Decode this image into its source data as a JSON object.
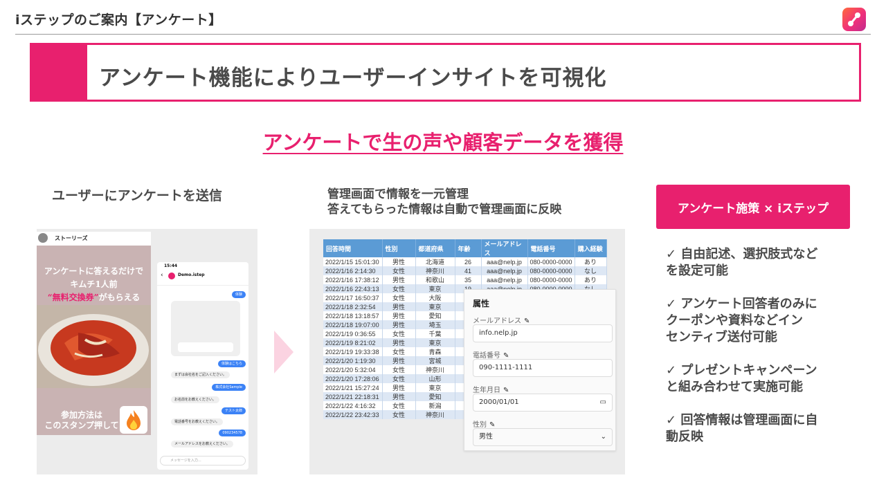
{
  "header": {
    "title": "iステップのご案内【アンケート】"
  },
  "headline": "アンケート機能によりユーザーインサイトを可視化",
  "sub_headline": "アンケートで生の声や顧客データを獲得",
  "col1": {
    "title": "ユーザーにアンケートを送信",
    "story": {
      "header_label": "ストーリーズ",
      "line1": "アンケートに答えるだけで",
      "line2": "キムチ1人前",
      "line3a": "“無料交換券”",
      "line3b": "がもらえる",
      "line4": "参加方法は",
      "line5": "このスタンプ押して"
    },
    "chat": {
      "time": "15:44",
      "account": "Demo.istep",
      "bubbles_right": [
        "体験",
        "体験はこちら",
        "株式会社Sample",
        "テスト太郎",
        "090234578"
      ],
      "bubbles_left": [
        "まずは会社名をご記入ください。",
        "お名前をお教えください。",
        "電話番号をお教えください。",
        "メールアドレスをお教えください。"
      ],
      "input_placeholder": "メッセージを入力..."
    }
  },
  "col2": {
    "title_line1": "管理画面で情報を一元管理",
    "title_line2": "答えてもらった情報は自動で管理画面に反映",
    "table": {
      "headers": [
        "回答時間",
        "性別",
        "都道府県",
        "年齢",
        "メールアドレス",
        "電話番号",
        "購入経験"
      ],
      "rows": [
        [
          "2022/1/15 15:01:30",
          "男性",
          "北海道",
          "26",
          "aaa@nelp.jp",
          "080-0000-0000",
          "あり"
        ],
        [
          "2022/1/16 2:14:30",
          "女性",
          "神奈川",
          "41",
          "aaa@nelp.jp",
          "080-0000-0000",
          "なし"
        ],
        [
          "2022/1/16 17:38:12",
          "男性",
          "和歌山",
          "35",
          "aaa@nelp.jp",
          "080-0000-0000",
          "あり"
        ],
        [
          "2022/1/16 22:43:13",
          "女性",
          "東京",
          "19",
          "aaa@nelp.jp",
          "080-0000-0000",
          "なし"
        ],
        [
          "2022/1/17 16:50:37",
          "女性",
          "大阪",
          "",
          "",
          "",
          ""
        ],
        [
          "2022/1/18 2:32:54",
          "男性",
          "東京",
          "",
          "",
          "",
          ""
        ],
        [
          "2022/1/18 13:18:57",
          "男性",
          "愛知",
          "",
          "",
          "",
          ""
        ],
        [
          "2022/1/18 19:07:00",
          "男性",
          "埼玉",
          "",
          "",
          "",
          ""
        ],
        [
          "2022/1/19 0:36:55",
          "女性",
          "千葉",
          "",
          "",
          "",
          ""
        ],
        [
          "2022/1/19 8:21:02",
          "男性",
          "東京",
          "",
          "",
          "",
          ""
        ],
        [
          "2022/1/19 19:33:38",
          "女性",
          "青森",
          "",
          "",
          "",
          ""
        ],
        [
          "2022/1/20 1:19:30",
          "男性",
          "宮城",
          "",
          "",
          "",
          ""
        ],
        [
          "2022/1/20 5:32:04",
          "女性",
          "神奈川",
          "",
          "",
          "",
          ""
        ],
        [
          "2022/1/20 17:28:06",
          "女性",
          "山形",
          "",
          "",
          "",
          ""
        ],
        [
          "2022/1/21 15:27:24",
          "男性",
          "東京",
          "",
          "",
          "",
          ""
        ],
        [
          "2022/1/21 22:18:31",
          "男性",
          "愛知",
          "",
          "",
          "",
          ""
        ],
        [
          "2022/1/22 4:16:32",
          "女性",
          "新潟",
          "",
          "",
          "",
          ""
        ],
        [
          "2022/1/22 23:42:33",
          "女性",
          "神奈川",
          "",
          "",
          "",
          ""
        ]
      ]
    },
    "attr_panel": {
      "title": "属性",
      "fields": [
        {
          "label": "メールアドレス",
          "value": "info.nelp.jp"
        },
        {
          "label": "電話番号",
          "value": "090-1111-1111"
        },
        {
          "label": "生年月日",
          "value": "2000/01/01"
        },
        {
          "label": "性別",
          "value": "男性"
        }
      ]
    }
  },
  "col3": {
    "badge": "アンケート施策 × iステップ",
    "features": [
      "✓ 自由記述、選択肢式など\nを設定可能",
      "✓ アンケート回答者のみに\nクーポンや資料などイン\nセンティブ送付可能",
      "✓ プレゼントキャンペーン\nと組み合わせて実施可能",
      "✓ 回答情報は管理画面に自\n動反映"
    ]
  },
  "colors": {
    "accent": "#e8206e",
    "table_header": "#5b9bd5",
    "text": "#4a4a4a"
  }
}
